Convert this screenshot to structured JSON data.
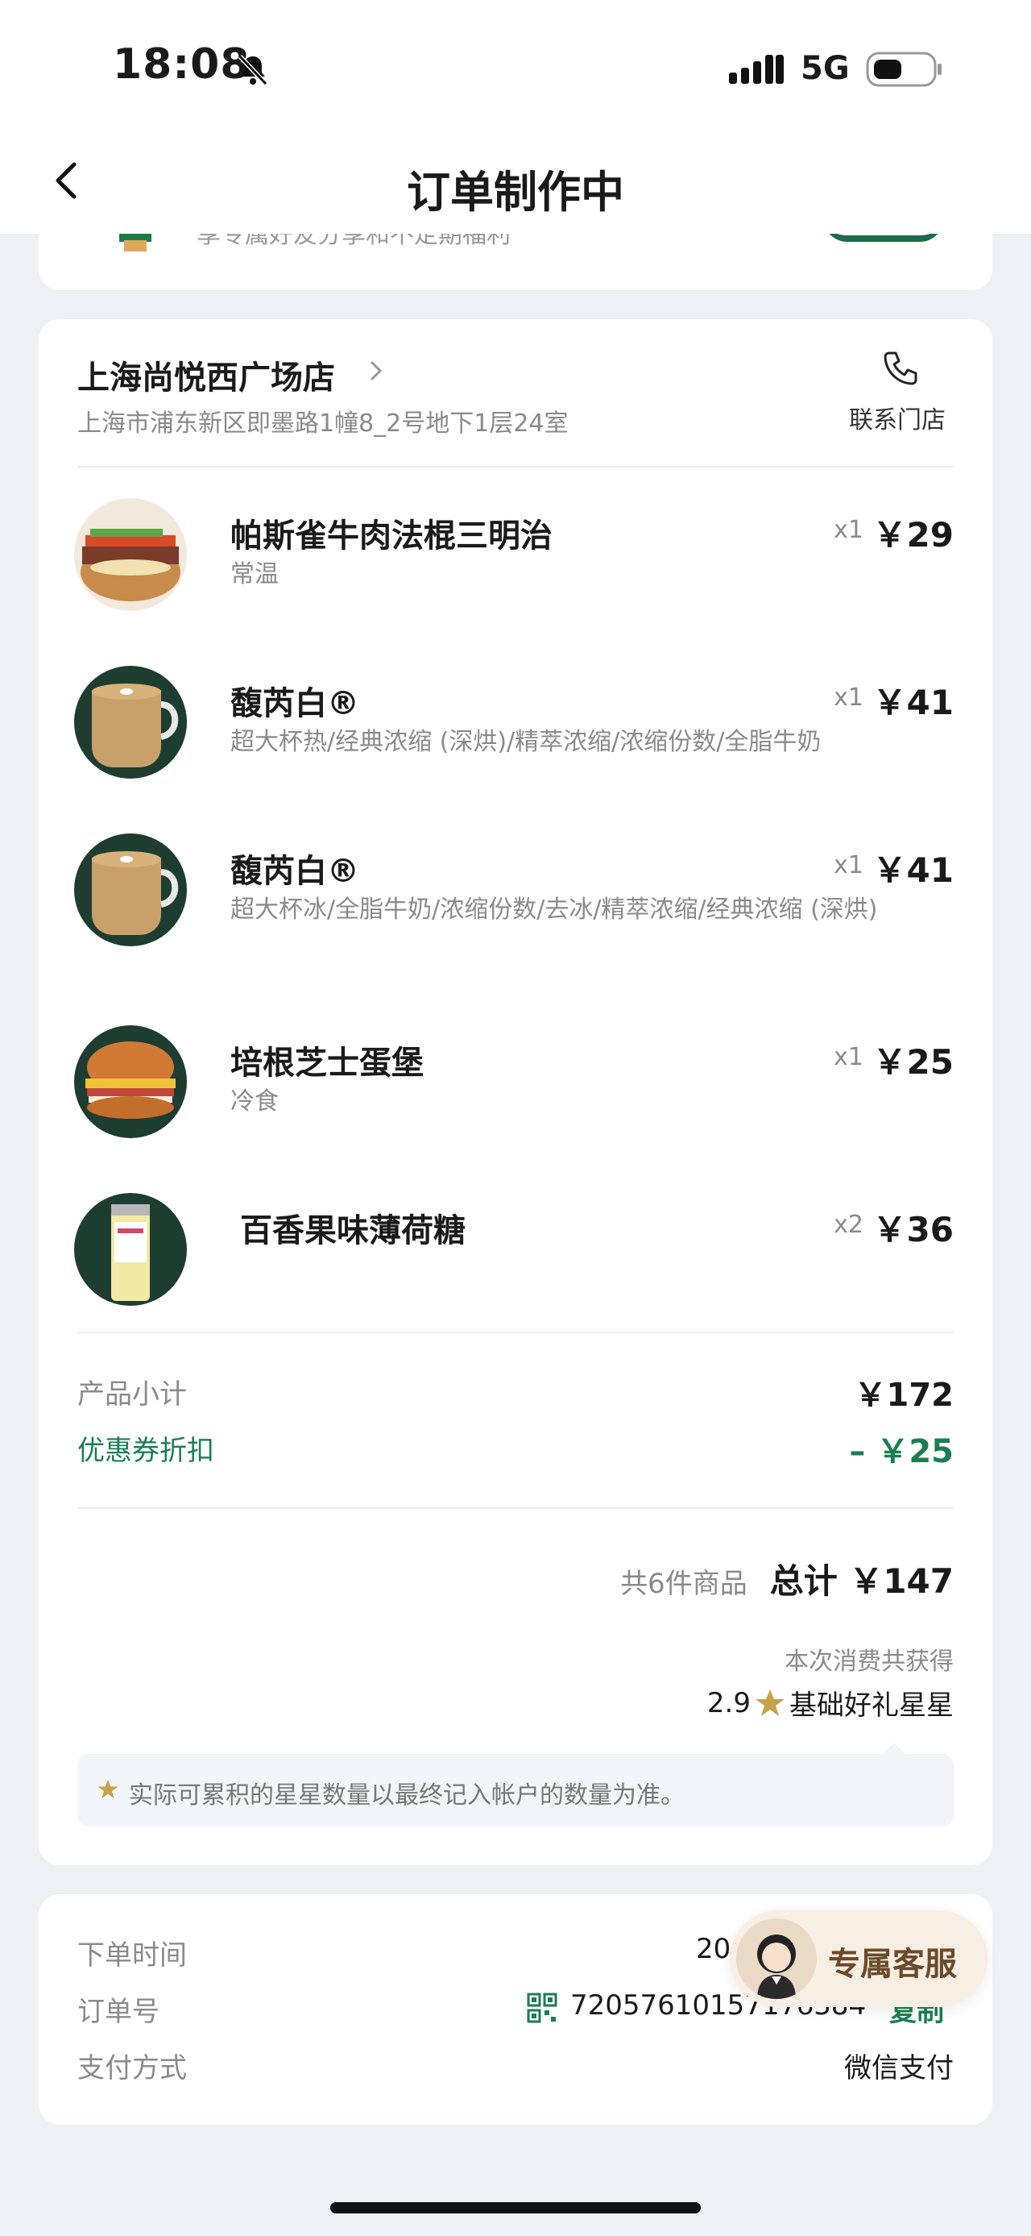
{
  "status_bar": {
    "time": "18:08",
    "network": "5G"
  },
  "nav": {
    "title": "订单制作中"
  },
  "promo_peek": {
    "text": "享专属好友分享和不定期福利"
  },
  "store": {
    "name": "上海尚悦西广场店",
    "address": "上海市浦东新区即墨路1幢8_2号地下1层24室",
    "contact_label": "联系门店"
  },
  "items": [
    {
      "name": "帕斯雀牛肉法棍三明治",
      "desc": "常温",
      "qty": "x1",
      "price": "￥29",
      "image": "sandwich-image"
    },
    {
      "name": "馥芮白®",
      "desc": "超大杯热/经典浓缩 (深烘)/精萃浓缩/浓缩份数/全脂牛奶",
      "qty": "x1",
      "price": "￥41",
      "image": "coffee-image"
    },
    {
      "name": "馥芮白®",
      "desc": "超大杯冰/全脂牛奶/浓缩份数/去冰/精萃浓缩/经典浓缩 (深烘)",
      "qty": "x1",
      "price": "￥41",
      "image": "coffee-image"
    },
    {
      "name": "培根芝士蛋堡",
      "desc": "冷食",
      "qty": "x1",
      "price": "￥25",
      "image": "burger-image"
    },
    {
      "name": "百香果味薄荷糖",
      "desc": "",
      "qty": "x2",
      "price": "￥36",
      "image": "mint-candy-image"
    }
  ],
  "summary": {
    "subtotal_label": "产品小计",
    "subtotal_value": "￥172",
    "coupon_label": "优惠券折扣",
    "coupon_value": "– ￥25",
    "count_text": "共6件商品",
    "total_text": "总计 ￥147",
    "earned_label": "本次消费共获得",
    "earned_value": "2.9",
    "earned_unit": "基础好礼星星",
    "notice": "实际可累积的星星数量以最终记入帐户的数量为准。"
  },
  "order_info": {
    "time_label": "下单时间",
    "time_value": "20",
    "number_label": "订单号",
    "number_value": "7205761015717б384",
    "copy_label": "复制",
    "payment_label": "支付方式",
    "payment_value": "微信支付"
  },
  "service": {
    "label": "专属客服"
  },
  "colors": {
    "accent_green": "#1b7e52",
    "dark_green": "#1d3d31",
    "background": "#eef0f3"
  }
}
